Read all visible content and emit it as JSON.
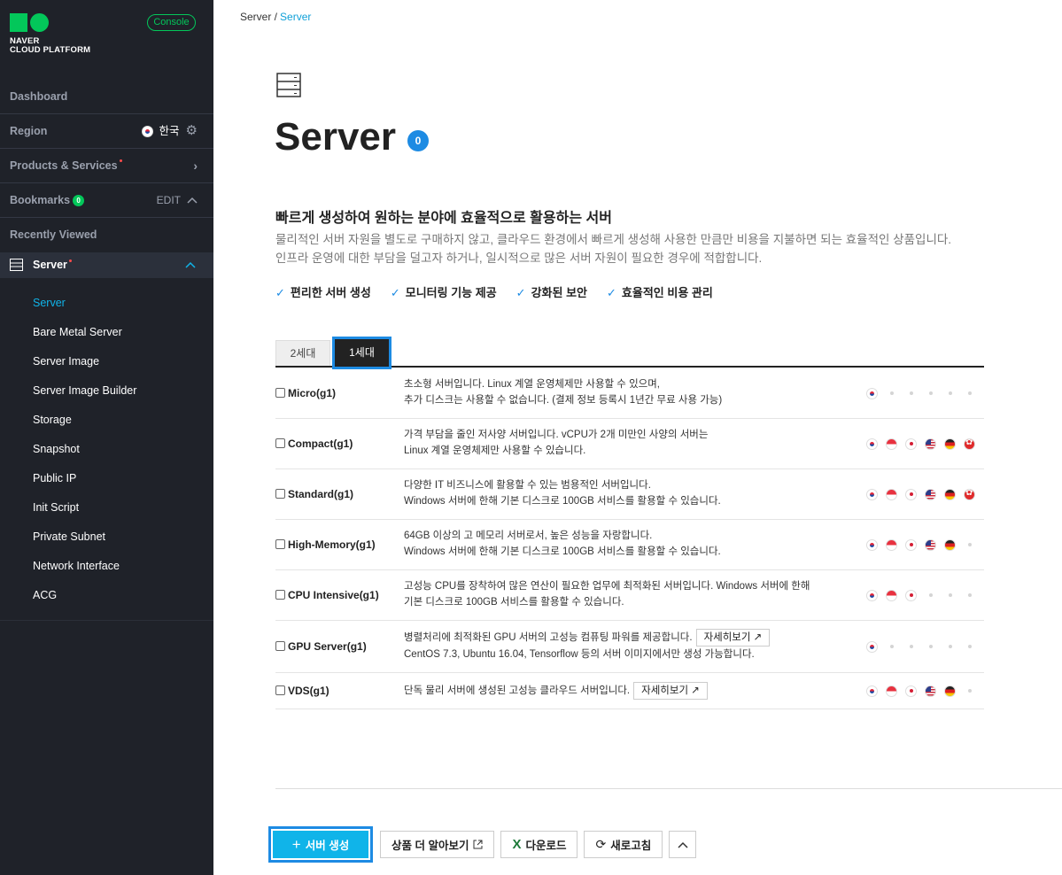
{
  "sidebar": {
    "logo_line1": "NAVER",
    "logo_line2": "CLOUD PLATFORM",
    "console_label": "Console",
    "dashboard": "Dashboard",
    "region": "Region",
    "region_value": "한국",
    "products": "Products & Services",
    "bookmarks": "Bookmarks",
    "bookmarks_count": "0",
    "bookmarks_edit": "EDIT",
    "recently_viewed": "Recently Viewed",
    "server_group": "Server",
    "items": [
      {
        "label": "Server",
        "active": true
      },
      {
        "label": "Bare Metal Server"
      },
      {
        "label": "Server Image"
      },
      {
        "label": "Server Image Builder"
      },
      {
        "label": "Storage"
      },
      {
        "label": "Snapshot"
      },
      {
        "label": "Public IP"
      },
      {
        "label": "Init Script"
      },
      {
        "label": "Private Subnet"
      },
      {
        "label": "Network Interface"
      },
      {
        "label": "ACG"
      }
    ]
  },
  "breadcrumb": {
    "root": "Server /",
    "current": "Server"
  },
  "page": {
    "title": "Server",
    "count": "0",
    "subhead": "빠르게 생성하여 원하는 분야에 효율적으로 활용하는 서버",
    "desc1": "물리적인 서버 자원을 별도로 구매하지 않고, 클라우드 환경에서 빠르게 생성해 사용한 만큼만 비용을 지불하면 되는 효율적인 상품입니다.",
    "desc2": "인프라 운영에 대한 부담을 덜고자 하거나, 일시적으로 많은 서버 자원이 필요한 경우에 적합합니다.",
    "features": [
      "편리한 서버 생성",
      "모니터링 기능 제공",
      "강화된 보안",
      "효율적인 비용 관리"
    ]
  },
  "tabs": {
    "gen2": "2세대",
    "gen1": "1세대"
  },
  "rows": [
    {
      "name": "Micro(g1)",
      "l1": "초소형 서버입니다. Linux 계열 운영체제만 사용할 수 있으며,",
      "l2": "추가 디스크는 사용할 수 없습니다. (결제 정보 등록시 1년간 무료 사용 가능)",
      "flags": [
        "kr",
        "",
        "",
        "",
        "",
        ""
      ]
    },
    {
      "name": "Compact(g1)",
      "l1": "가격 부담을 줄인 저사양 서버입니다. vCPU가 2개 미만인 사양의 서버는",
      "l2": "Linux 계열 운영체제만 사용할 수 있습니다.",
      "flags": [
        "kr",
        "sg",
        "jp",
        "us",
        "de",
        "hk"
      ]
    },
    {
      "name": "Standard(g1)",
      "l1": "다양한 IT 비즈니스에 활용할 수 있는 범용적인 서버입니다.",
      "l2": "Windows 서버에 한해 기본 디스크로 100GB 서비스를 활용할 수 있습니다.",
      "flags": [
        "kr",
        "sg",
        "jp",
        "us",
        "de",
        "hk"
      ]
    },
    {
      "name": "High-Memory(g1)",
      "l1": "64GB 이상의 고 메모리 서버로서, 높은 성능을 자랑합니다.",
      "l2": "Windows 서버에 한해 기본 디스크로 100GB 서비스를 활용할 수 있습니다.",
      "flags": [
        "kr",
        "sg",
        "jp",
        "us",
        "de",
        ""
      ]
    },
    {
      "name": "CPU Intensive(g1)",
      "l1": "고성능 CPU를 장착하여 많은 연산이 필요한 업무에 최적화된 서버입니다. Windows 서버에 한해",
      "l2": "기본 디스크로 100GB 서비스를 활용할 수 있습니다.",
      "flags": [
        "kr",
        "sg",
        "jp",
        "",
        "",
        ""
      ]
    },
    {
      "name": "GPU Server(g1)",
      "l1": "병렬처리에 최적화된 GPU 서버의 고성능 컴퓨팅 파워를 제공합니다.",
      "more": "자세히보기",
      "l2": "CentOS 7.3, Ubuntu 16.04, Tensorflow 등의 서버 이미지에서만 생성 가능합니다.",
      "flags": [
        "kr",
        "",
        "",
        "",
        "",
        ""
      ]
    },
    {
      "name": "VDS(g1)",
      "l1": "단독 물리 서버에 생성된 고성능 클라우드 서버입니다.",
      "more": "자세히보기",
      "l2": "",
      "flags": [
        "kr",
        "sg",
        "jp",
        "us",
        "de",
        ""
      ]
    }
  ],
  "actions": {
    "create": "서버 생성",
    "learn_more": "상품 더 알아보기",
    "download": "다운로드",
    "refresh": "새로고침"
  },
  "colors": {
    "accent": "#10b4e9",
    "brand_green": "#03c75a",
    "sidebar_bg": "#1f2229"
  }
}
